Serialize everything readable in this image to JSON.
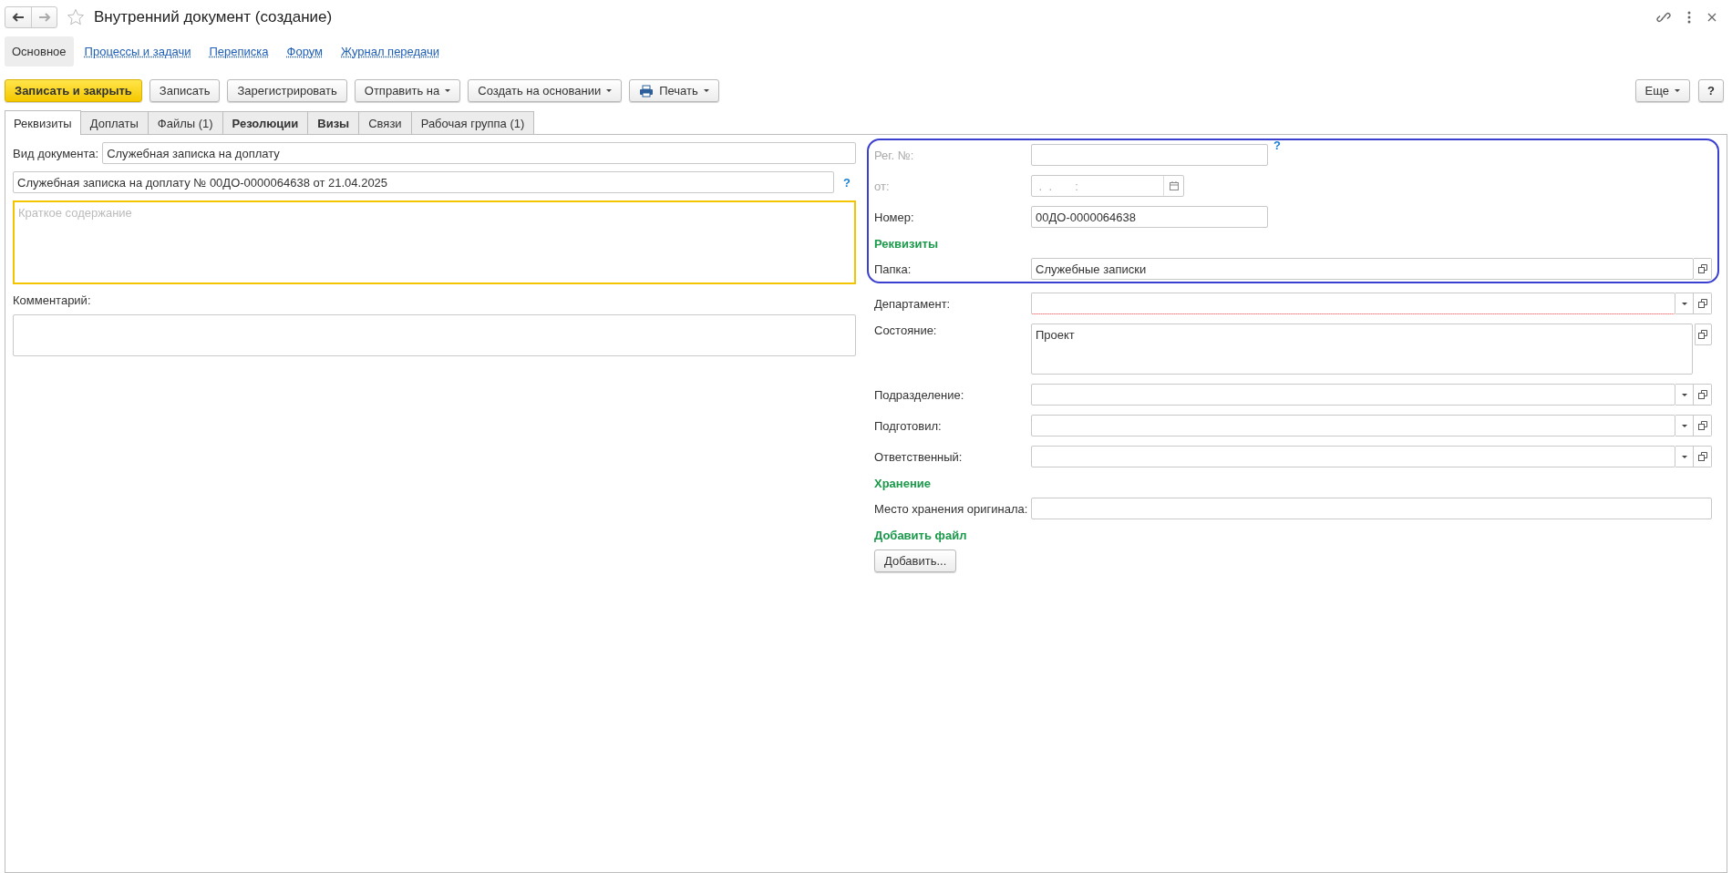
{
  "window": {
    "title": "Внутренний документ (создание)",
    "favorite": false
  },
  "nav_links": [
    {
      "label": "Основное",
      "selected": true
    },
    {
      "label": "Процессы и задачи",
      "selected": false
    },
    {
      "label": "Переписка",
      "selected": false
    },
    {
      "label": "Форум",
      "selected": false
    },
    {
      "label": "Журнал передачи",
      "selected": false
    }
  ],
  "toolbar": {
    "buttons": [
      {
        "label": "Записать и закрыть",
        "kind": "primary"
      },
      {
        "label": "Записать",
        "kind": "plain"
      },
      {
        "label": "Зарегистрировать",
        "kind": "plain"
      },
      {
        "label": "Отправить на",
        "kind": "menu"
      },
      {
        "label": "Создать на основании",
        "kind": "menu"
      },
      {
        "label": "Печать",
        "kind": "print"
      }
    ],
    "right_buttons": [
      {
        "label": "Еще",
        "kind": "menu"
      },
      {
        "label": "?",
        "kind": "help"
      }
    ]
  },
  "tabs": [
    {
      "label": "Реквизиты",
      "selected": true,
      "bold": false
    },
    {
      "label": "Доплаты",
      "selected": false,
      "bold": false
    },
    {
      "label": "Файлы (1)",
      "selected": false,
      "bold": false
    },
    {
      "label": "Резолюции",
      "selected": false,
      "bold": true
    },
    {
      "label": "Визы",
      "selected": false,
      "bold": true
    },
    {
      "label": "Связи",
      "selected": false,
      "bold": false
    },
    {
      "label": "Рабочая группа (1)",
      "selected": false,
      "bold": false
    }
  ],
  "left": {
    "document_type": {
      "label": "Вид документа:",
      "value": "Служебная записка на доплату"
    },
    "title_field": {
      "value": "Служебная записка на доплату № 00ДО-0000064638 от 21.04.2025",
      "help": "?"
    },
    "summary": {
      "placeholder": "Краткое содержание",
      "focused": true
    },
    "comment": {
      "label": "Комментарий:"
    }
  },
  "right": {
    "rows": [
      {
        "kind": "short",
        "label": "Рег. №:",
        "help": "?",
        "disabled": true,
        "required": false,
        "highlighted": true
      },
      {
        "kind": "date",
        "label": "от:",
        "mask": " .  .       :",
        "disabled": true,
        "required": false,
        "highlighted": true
      },
      {
        "kind": "short",
        "label": "Номер:",
        "value": "00ДО-0000064638",
        "disabled": false,
        "required": false,
        "highlighted": true
      },
      {
        "kind": "heading",
        "label": "Реквизиты",
        "highlighted": true
      },
      {
        "kind": "ref",
        "label": "Папка:",
        "value": "Служебные записки",
        "disabled": false,
        "required": false,
        "highlighted": true
      },
      {
        "kind": "select",
        "label": "Департамент:",
        "disabled": false,
        "required": true,
        "highlighted": false
      },
      {
        "kind": "memo",
        "label": "Состояние:",
        "value": "Проект",
        "disabled": false,
        "required": false,
        "highlighted": false
      },
      {
        "kind": "select",
        "label": "Подразделение:",
        "disabled": false,
        "required": false,
        "highlighted": false
      },
      {
        "kind": "select",
        "label": "Подготовил:",
        "disabled": false,
        "required": false,
        "highlighted": false
      },
      {
        "kind": "select",
        "label": "Ответственный:",
        "disabled": false,
        "required": false,
        "highlighted": false
      },
      {
        "kind": "heading",
        "label": "Хранение",
        "highlighted": false
      },
      {
        "kind": "text",
        "label": "Место хранения оригинала:",
        "disabled": false,
        "required": false,
        "highlighted": false
      },
      {
        "kind": "heading",
        "label": "Добавить файл",
        "highlighted": false
      },
      {
        "kind": "button",
        "label": "Добавить...",
        "highlighted": false
      }
    ]
  }
}
